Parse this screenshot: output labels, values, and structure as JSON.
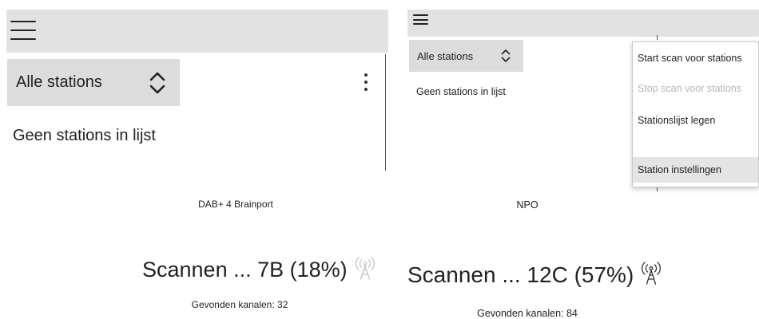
{
  "left": {
    "dropdown": {
      "selected": "Alle stations"
    },
    "empty_text": "Geen stations in lijst"
  },
  "right": {
    "dropdown": {
      "selected": "Alle stations"
    },
    "empty_text": "Geen stations in lijst",
    "menu": {
      "items": [
        {
          "label": "Start scan voor stations",
          "enabled": true
        },
        {
          "label": "Stop scan voor stations",
          "enabled": false
        },
        {
          "label": "Stationslijst legen",
          "enabled": true
        },
        {
          "label": "Station instellingen",
          "enabled": true,
          "highlighted": true
        }
      ]
    }
  },
  "scan_left": {
    "station": "DAB+ 4 Brainport",
    "status": "Scannen ... 7B (18%)",
    "percent": 18,
    "found": "Gevonden kanalen: 32"
  },
  "scan_right": {
    "station": "NPO",
    "status": "Scannen ... 12C (57%)",
    "percent": 57,
    "found": "Gevonden kanalen: 84"
  },
  "icons": {
    "menu": "hamburger-icon",
    "dropdown": "chevron-up-down-icon",
    "overflow": "more-vert-icon",
    "signal_left": "antenna-signal-icon-inactive",
    "signal_right": "antenna-signal-icon-active"
  },
  "colors": {
    "toolbar": "#e2e2e2",
    "dropdown": "#dcdcdc",
    "disabled_text": "#b5b5b5",
    "highlight": "#e4e4e4",
    "antenna_inactive": "#c4c4c4",
    "antenna_active": "#333333"
  }
}
